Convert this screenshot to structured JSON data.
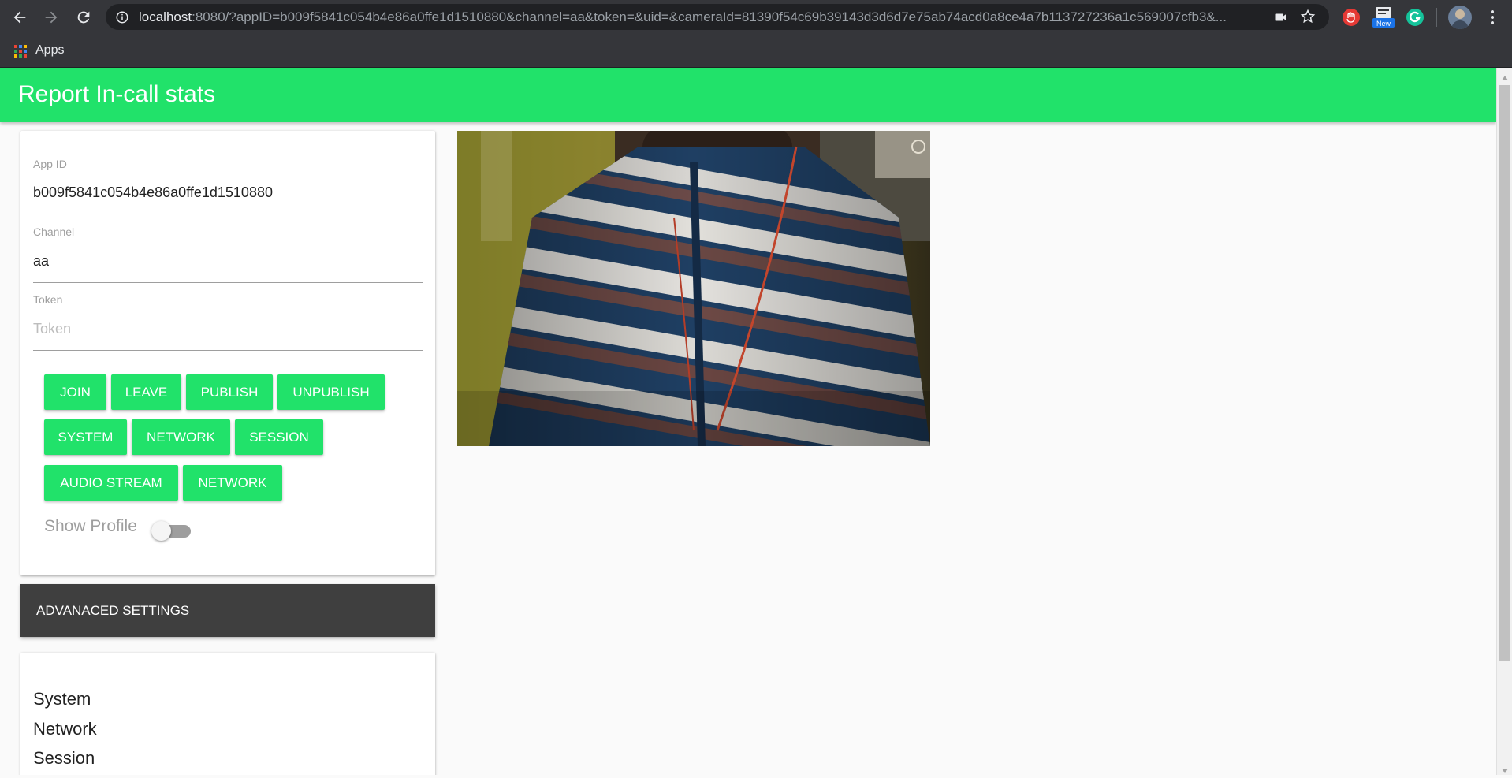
{
  "browser": {
    "url_host": "localhost",
    "url_rest": ":8080/?appID=b009f5841c054b4e86a0ffe1d1510880&channel=aa&token=&uid=&cameraId=81390f54c69b39143d3d6d7e75ab74acd0a8ce4a7b113727236a1c569007cfb3&...",
    "bookmarks_apps_label": "Apps",
    "ext_new_badge": "New",
    "icons": [
      "back-icon",
      "forward-icon",
      "reload-icon",
      "info-icon",
      "camera-icon",
      "star-icon",
      "extension-stop-icon",
      "extension-new-icon",
      "grammarly-icon",
      "profile-avatar",
      "menu-icon",
      "apps-grid-icon"
    ]
  },
  "app": {
    "title": "Report In-call stats",
    "accent_color": "#21e26a",
    "form": {
      "app_id_label": "App ID",
      "app_id_value": "b009f5841c054b4e86a0ffe1d1510880",
      "channel_label": "Channel",
      "channel_value": "aa",
      "token_label": "Token",
      "token_value": "",
      "token_placeholder": "Token"
    },
    "buttons": {
      "join": "JOIN",
      "leave": "LEAVE",
      "publish": "PUBLISH",
      "unpublish": "UNPUBLISH",
      "system": "SYSTEM",
      "network": "NETWORK",
      "session": "SESSION",
      "audio_stream": "AUDIO STREAM",
      "network2": "NETWORK"
    },
    "show_profile": {
      "label": "Show Profile",
      "enabled": false
    },
    "advanced_settings_label": "ADVANACED SETTINGS",
    "stats_list": [
      "System",
      "Network",
      "Session"
    ]
  }
}
